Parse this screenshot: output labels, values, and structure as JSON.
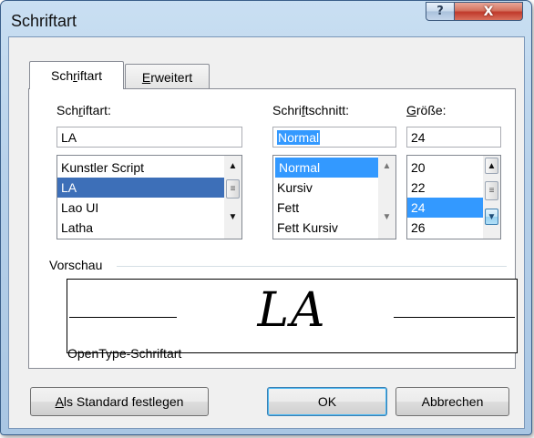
{
  "window": {
    "title": "Schriftart"
  },
  "titlebar": {
    "help_label": "?",
    "close_label": "X"
  },
  "tabs": [
    {
      "pre": "Sch",
      "ul": "r",
      "post": "iftart",
      "active": true
    },
    {
      "pre": "",
      "ul": "E",
      "post": "rweitert",
      "active": false
    }
  ],
  "font": {
    "label_pre": "Sch",
    "label_ul": "r",
    "label_post": "iftart:",
    "value": "LA",
    "items": [
      "Kunstler Script",
      "LA",
      "Lao UI",
      "Latha"
    ],
    "selected": "LA"
  },
  "style": {
    "label_pre": "Schri",
    "label_ul": "f",
    "label_post": "tschnitt:",
    "value": "Normal",
    "items": [
      "Normal",
      "Kursiv",
      "Fett",
      "Fett Kursiv"
    ],
    "selected": "Normal"
  },
  "size": {
    "label_pre": "",
    "label_ul": "G",
    "label_post": "röße:",
    "value": "24",
    "items": [
      "20",
      "22",
      "24",
      "26"
    ],
    "selected": "24"
  },
  "preview": {
    "label": "Vorschau",
    "sample": "LA",
    "font_type": "OpenType-Schriftart"
  },
  "buttons": {
    "default_pre": "",
    "default_ul": "A",
    "default_post": "ls Standard festlegen",
    "ok": "OK",
    "cancel": "Abbrechen"
  }
}
